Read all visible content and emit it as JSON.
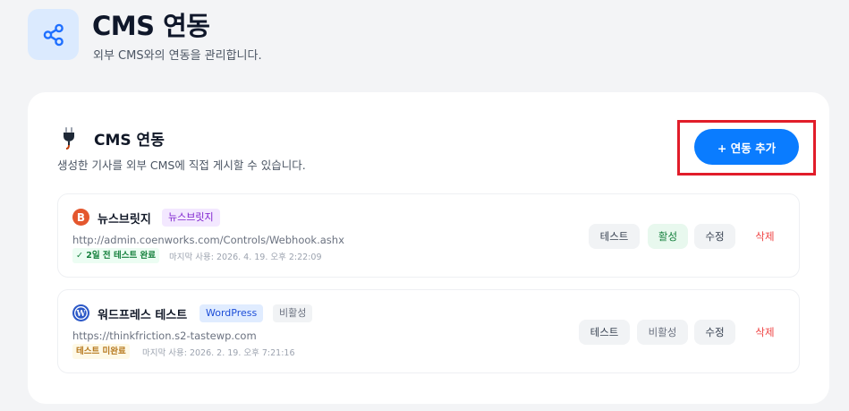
{
  "header": {
    "title": "CMS 연동",
    "subtitle": "외부 CMS와의 연동을 관리합니다."
  },
  "section": {
    "title": "CMS 연동",
    "description": "생성한 기사를 외부 CMS에 직접 게시할 수 있습니다.",
    "add_button": "+ 연동 추가"
  },
  "integrations": [
    {
      "name": "뉴스브릿지",
      "type_tag": "뉴스브릿지",
      "url": "http://admin.coenworks.com/Controls/Webhook.ashx",
      "test_status": "✓ 2일 전 테스트 완료",
      "last_used": "마지막 사용: 2026. 4. 19. 오후 2:22:09",
      "buttons": {
        "test": "테스트",
        "toggle": "활성",
        "edit": "수정",
        "delete": "삭제"
      }
    },
    {
      "name": "워드프레스 테스트",
      "type_tag": "WordPress",
      "state_tag": "비활성",
      "url": "https://thinkfriction.s2-tastewp.com",
      "test_status": "테스트 미완료",
      "last_used": "마지막 사용: 2026. 2. 19. 오후 7:21:16",
      "buttons": {
        "test": "테스트",
        "toggle": "비활성",
        "edit": "수정",
        "delete": "삭제"
      }
    }
  ],
  "icons": {
    "header": "share-icon",
    "section": "plug-icon",
    "row1_logo": "blogger-b-icon",
    "row2_logo": "wordpress-icon"
  },
  "colors": {
    "primary": "#0a7cff",
    "highlight": "#e11d2a",
    "danger": "#ef4444",
    "success": "#15803d"
  }
}
